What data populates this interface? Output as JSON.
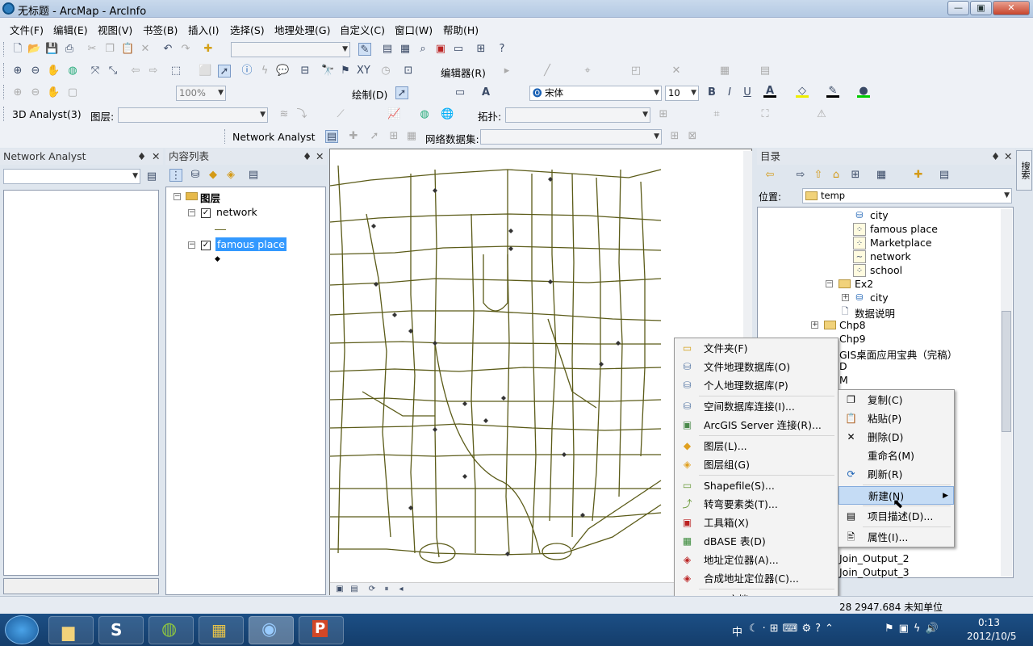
{
  "window": {
    "title": "无标题 - ArcMap - ArcInfo",
    "min": "—",
    "max": "▣",
    "close": "✕"
  },
  "menu": [
    "文件(F)",
    "编辑(E)",
    "视图(V)",
    "书签(B)",
    "插入(I)",
    "选择(S)",
    "地理处理(G)",
    "自定义(C)",
    "窗口(W)",
    "帮助(H)"
  ],
  "toolbar3": {
    "zoom": "100%",
    "draw": "绘制(D)",
    "font": "宋体",
    "size": "10",
    "bold": "B",
    "italic": "I",
    "underline": "U",
    "textcolor": "A"
  },
  "toolbar2": {
    "editor": "编辑器(R)"
  },
  "toolbar4": {
    "analyst3d": "3D Analyst(3)",
    "layer_label": "图层:",
    "topology": "拓扑:"
  },
  "toolbar5": {
    "network_analyst": "Network Analyst",
    "network_dataset": "网络数据集:"
  },
  "left_panel": {
    "title": "Network Analyst",
    "pin": "♦",
    "close": "✕"
  },
  "toc": {
    "title": "内容列表",
    "root": "图层",
    "layers": [
      "network",
      "famous place"
    ]
  },
  "catalog": {
    "title": "目录",
    "location_label": "位置:",
    "location": "temp",
    "items": [
      "city",
      "famous place",
      "Marketplace",
      "network",
      "school",
      "Ex2",
      "city",
      "数据说明",
      "Chp8",
      "Chp9",
      "GIS桌面应用宝典（完稿）",
      "D",
      "M",
      "Join_Output_2",
      "Join_Output_3"
    ]
  },
  "side_tab": "搜索",
  "context_menu": {
    "items": [
      "复制(C)",
      "粘贴(P)",
      "删除(D)",
      "重命名(M)",
      "刷新(R)",
      "新建(N)",
      "项目描述(D)...",
      "属性(I)..."
    ]
  },
  "new_submenu": {
    "items": [
      "文件夹(F)",
      "文件地理数据库(O)",
      "个人地理数据库(P)",
      "空间数据库连接(I)...",
      "ArcGIS Server 连接(R)...",
      "图层(L)...",
      "图层组(G)",
      "Shapefile(S)...",
      "转弯要素类(T)...",
      "工具箱(X)",
      "dBASE 表(D)",
      "地址定位器(A)...",
      "合成地址定位器(C)...",
      "XML 文档"
    ]
  },
  "status": {
    "coords": "28  2947.684 未知单位"
  },
  "clock": {
    "time": "0:13",
    "date": "2012/10/5"
  },
  "tray": "中"
}
